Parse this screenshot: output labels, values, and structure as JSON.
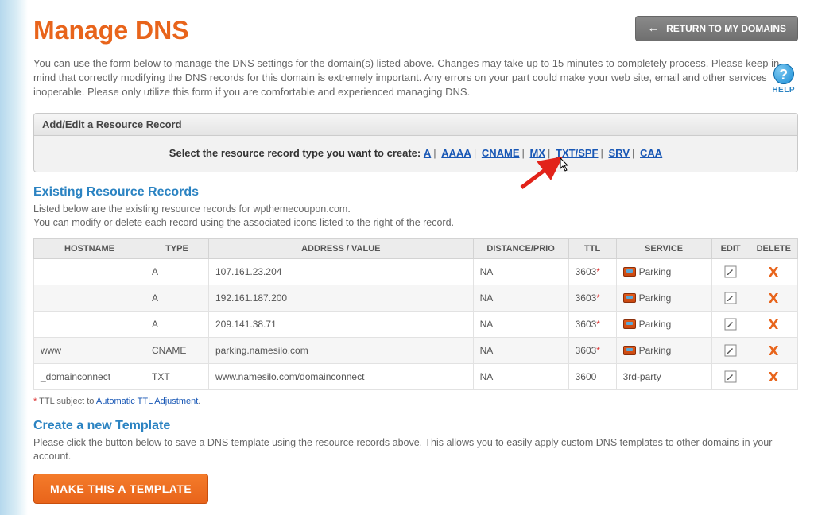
{
  "header": {
    "title": "Manage DNS",
    "return_button": "RETURN TO MY DOMAINS"
  },
  "intro": "You can use the form below to manage the DNS settings for the domain(s) listed above. Changes may take up to 15 minutes to completely process. Please keep in mind that correctly modifying the DNS records for this domain is extremely important. Any errors on your part could make your web site, email and other services inoperable. Please only utilize this form if you are comfortable and experienced managing DNS.",
  "help_label": "HELP",
  "add_edit": {
    "panel_title": "Add/Edit a Resource Record",
    "prompt": "Select the resource record type you want to create:",
    "types": [
      "A",
      "AAAA",
      "CNAME",
      "MX",
      "TXT/SPF",
      "SRV",
      "CAA"
    ]
  },
  "existing": {
    "title": "Existing Resource Records",
    "desc_line1": "Listed below are the existing resource records for wpthemecoupon.com.",
    "desc_line2": "You can modify or delete each record using the associated icons listed to the right of the record.",
    "columns": {
      "hostname": "HOSTNAME",
      "type": "TYPE",
      "address": "ADDRESS / VALUE",
      "distance": "DISTANCE/PRIO",
      "ttl": "TTL",
      "service": "SERVICE",
      "edit": "EDIT",
      "delete": "DELETE"
    },
    "rows": [
      {
        "hostname": "",
        "type": "A",
        "address": "107.161.23.204",
        "distance": "NA",
        "ttl": "3603",
        "ttl_star": true,
        "service": "Parking",
        "service_icon": true
      },
      {
        "hostname": "",
        "type": "A",
        "address": "192.161.187.200",
        "distance": "NA",
        "ttl": "3603",
        "ttl_star": true,
        "service": "Parking",
        "service_icon": true
      },
      {
        "hostname": "",
        "type": "A",
        "address": "209.141.38.71",
        "distance": "NA",
        "ttl": "3603",
        "ttl_star": true,
        "service": "Parking",
        "service_icon": true
      },
      {
        "hostname": "www",
        "type": "CNAME",
        "address": "parking.namesilo.com",
        "distance": "NA",
        "ttl": "3603",
        "ttl_star": true,
        "service": "Parking",
        "service_icon": true
      },
      {
        "hostname": "_domainconnect",
        "type": "TXT",
        "address": "www.namesilo.com/domainconnect",
        "distance": "NA",
        "ttl": "3600",
        "ttl_star": false,
        "service": "3rd-party",
        "service_icon": false
      }
    ]
  },
  "footnote": {
    "prefix": "TTL subject to ",
    "link": "Automatic TTL Adjustment",
    "suffix": "."
  },
  "template": {
    "title": "Create a new Template",
    "desc": "Please click the button below to save a DNS template using the resource records above. This allows you to easily apply custom DNS templates to other domains in your account.",
    "button": "MAKE THIS A TEMPLATE"
  }
}
